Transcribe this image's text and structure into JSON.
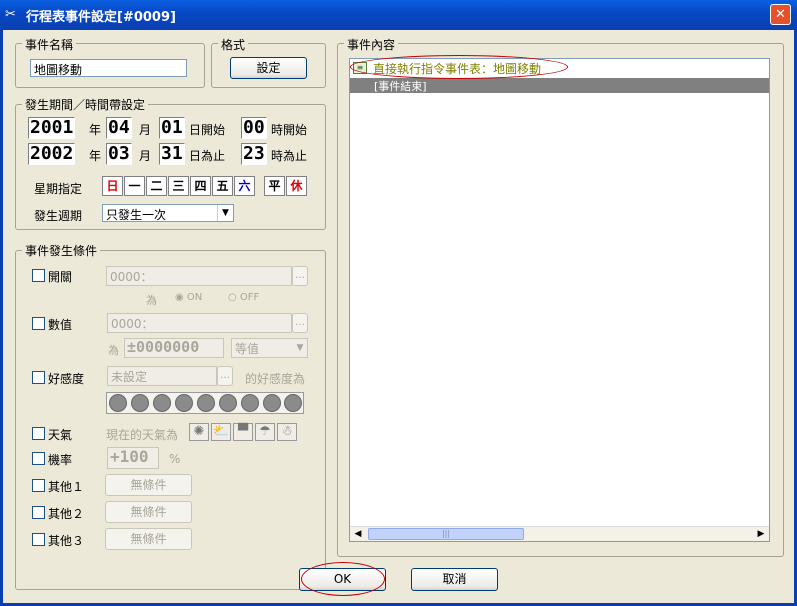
{
  "window": {
    "title": "行程表事件設定[#0009]"
  },
  "event_name": {
    "label": "事件名稱",
    "value": "地圖移動"
  },
  "format": {
    "label": "格式",
    "button": "設定"
  },
  "period": {
    "label": "發生期間／時間帶設定",
    "start": {
      "year": "2001",
      "month": "04",
      "day": "01",
      "hour": "00"
    },
    "end": {
      "year": "2002",
      "month": "03",
      "day": "31",
      "hour": "23"
    },
    "units": {
      "year": "年",
      "month": "月",
      "start_day": "日開始",
      "start_hour": "時開始",
      "end_day": "日為止",
      "end_hour": "時為止"
    },
    "weekday_label": "星期指定",
    "weekdays": [
      "日",
      "一",
      "二",
      "三",
      "四",
      "五",
      "六"
    ],
    "special_days": [
      "平",
      "休"
    ],
    "cycle_label": "發生週期",
    "cycle_value": "只發生一次"
  },
  "conditions": {
    "label": "事件發生條件",
    "switch": {
      "label": "開關",
      "value": "0000：",
      "is_label": "為",
      "on": "ON",
      "off": "OFF"
    },
    "variable": {
      "label": "數值",
      "value": "0000：",
      "is_label": "為",
      "number": "±0000000",
      "op": "等值"
    },
    "favor": {
      "label": "好感度",
      "value": "未設定",
      "suffix": "的好感度為"
    },
    "weather": {
      "label": "天氣",
      "text": "現在的天氣為"
    },
    "probability": {
      "label": "機率",
      "value": "+100",
      "unit": "%"
    },
    "others": [
      {
        "label": "其他１",
        "button": "無條件"
      },
      {
        "label": "其他２",
        "button": "無條件"
      },
      {
        "label": "其他３",
        "button": "無條件"
      }
    ]
  },
  "contents": {
    "label": "事件內容",
    "items": [
      "直接執行指令事件表：地圖移動",
      "[事件結束]"
    ]
  },
  "buttons": {
    "ok": "OK",
    "cancel": "取消"
  },
  "colors": {
    "red_day": "#E00000",
    "blue_day": "#0000C0",
    "highlight_row": "#808080",
    "event_text": "#808000",
    "annotation": "#C00000"
  }
}
